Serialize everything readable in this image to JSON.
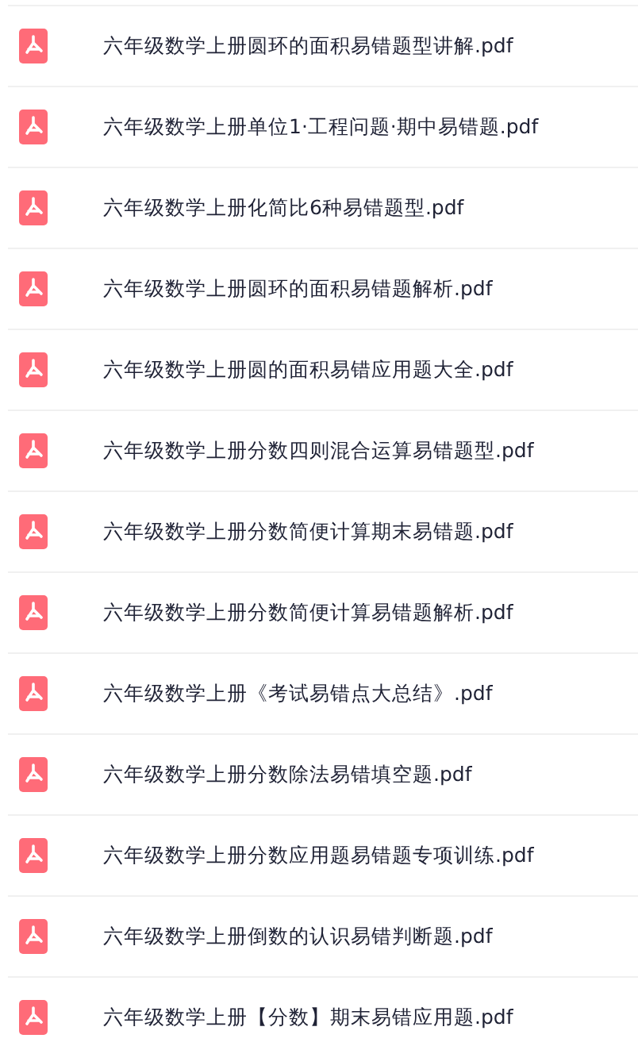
{
  "files": [
    {
      "name": "六年级数学上册圆环的面积易错题型讲解.pdf"
    },
    {
      "name": "六年级数学上册单位1·工程问题·期中易错题.pdf"
    },
    {
      "name": "六年级数学上册化简比6种易错题型.pdf"
    },
    {
      "name": "六年级数学上册圆环的面积易错题解析.pdf"
    },
    {
      "name": "六年级数学上册圆的面积易错应用题大全.pdf"
    },
    {
      "name": "六年级数学上册分数四则混合运算易错题型.pdf"
    },
    {
      "name": "六年级数学上册分数简便计算期末易错题.pdf"
    },
    {
      "name": "六年级数学上册分数简便计算易错题解析.pdf"
    },
    {
      "name": "六年级数学上册《考试易错点大总结》.pdf"
    },
    {
      "name": "六年级数学上册分数除法易错填空题.pdf"
    },
    {
      "name": "六年级数学上册分数应用题易错题专项训练.pdf"
    },
    {
      "name": "六年级数学上册倒数的认识易错判断题.pdf"
    },
    {
      "name": "六年级数学上册【分数】期末易错应用题.pdf"
    }
  ]
}
